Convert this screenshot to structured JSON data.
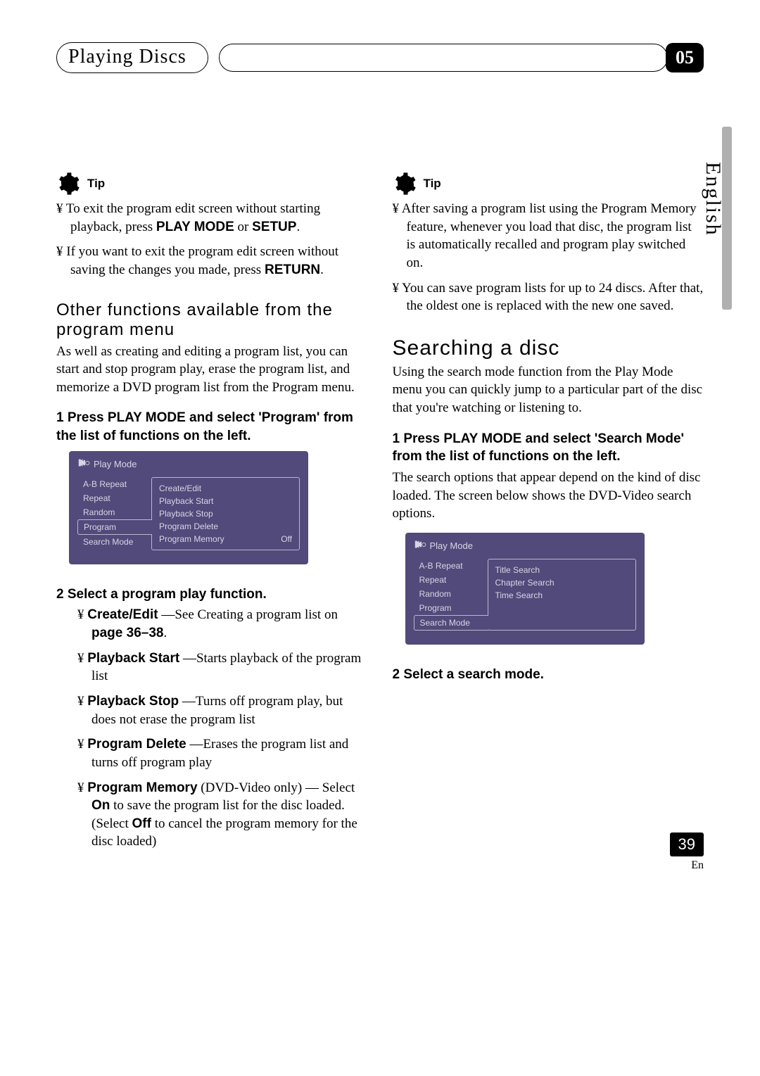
{
  "header": {
    "title": "Playing Discs",
    "chapter": "05"
  },
  "side_language": "English",
  "left": {
    "tip_label": "Tip",
    "tips": [
      {
        "pre": "To exit the program edit screen without starting playback, press ",
        "b1": "PLAY MODE",
        "mid": " or ",
        "b2": "SETUP",
        "post": "."
      },
      {
        "pre": "If you want to exit the program edit screen without saving the changes you made, press ",
        "b1": "RETURN",
        "post": "."
      }
    ],
    "section_title": "Other functions available from the program menu",
    "section_body": "As well as creating and editing a program list, you can start and stop program play, erase the program list, and memorize a DVD program list from the Program menu.",
    "step1": "1   Press PLAY MODE and select 'Program' from the list of functions on the left.",
    "osd1": {
      "title": "Play Mode",
      "left_items": [
        "A-B Repeat",
        "Repeat",
        "Random",
        "Program",
        "Search Mode"
      ],
      "selected_index": 3,
      "right_items": [
        {
          "label": "Create/Edit",
          "value": ""
        },
        {
          "label": "Playback Start",
          "value": ""
        },
        {
          "label": "Playback Stop",
          "value": ""
        },
        {
          "label": "Program Delete",
          "value": ""
        },
        {
          "label": "Program Memory",
          "value": "Off"
        }
      ]
    },
    "step2_title": "2   Select a program play function.",
    "functions": [
      {
        "name": "Create/Edit",
        "sep": " —See ",
        "plain": "Creating a program list",
        "tail_pre": " on ",
        "tail_b": "page 36–38",
        "tail_post": "."
      },
      {
        "name": "Playback Start",
        "sep": " —",
        "plain": "Starts playback of the program list"
      },
      {
        "name": "Playback Stop",
        "sep": " —",
        "plain": "Turns off program play, but does not erase the program list"
      },
      {
        "name": "Program Delete",
        "sep": " —",
        "plain": "Erases the program list and turns off program play"
      },
      {
        "name": "Program Memory",
        "note": " (DVD-Video only)",
        "sep": " — ",
        "plain_pre": "Select ",
        "b1": "On",
        "plain_mid": " to save the program list for the disc loaded. (Select ",
        "b2": "Off",
        "plain_post": " to cancel the program memory for the disc loaded)"
      }
    ]
  },
  "right": {
    "tip_label": "Tip",
    "tips": [
      "After saving a program list using the Program Memory feature, whenever you load that disc, the program list is automatically recalled and program play switched on.",
      "You can save program lists for up to 24 discs. After that, the oldest one is replaced with the new one saved."
    ],
    "section_title": "Searching a disc",
    "section_body": "Using the search mode function from the Play Mode menu you can quickly jump to a particular part of the disc that you're watching or listening to.",
    "step1": "1   Press PLAY MODE and select 'Search Mode' from the list of functions on the left.",
    "step1_body": "The search options that appear depend on the kind of disc loaded. The screen below shows the DVD-Video search options.",
    "osd2": {
      "title": "Play Mode",
      "left_items": [
        "A-B Repeat",
        "Repeat",
        "Random",
        "Program",
        "Search Mode"
      ],
      "selected_index": 4,
      "right_items": [
        {
          "label": "Title Search",
          "value": ""
        },
        {
          "label": "Chapter Search",
          "value": ""
        },
        {
          "label": "Time Search",
          "value": ""
        }
      ]
    },
    "step2_title": "2   Select a search mode."
  },
  "footer": {
    "page": "39",
    "lang": "En"
  }
}
